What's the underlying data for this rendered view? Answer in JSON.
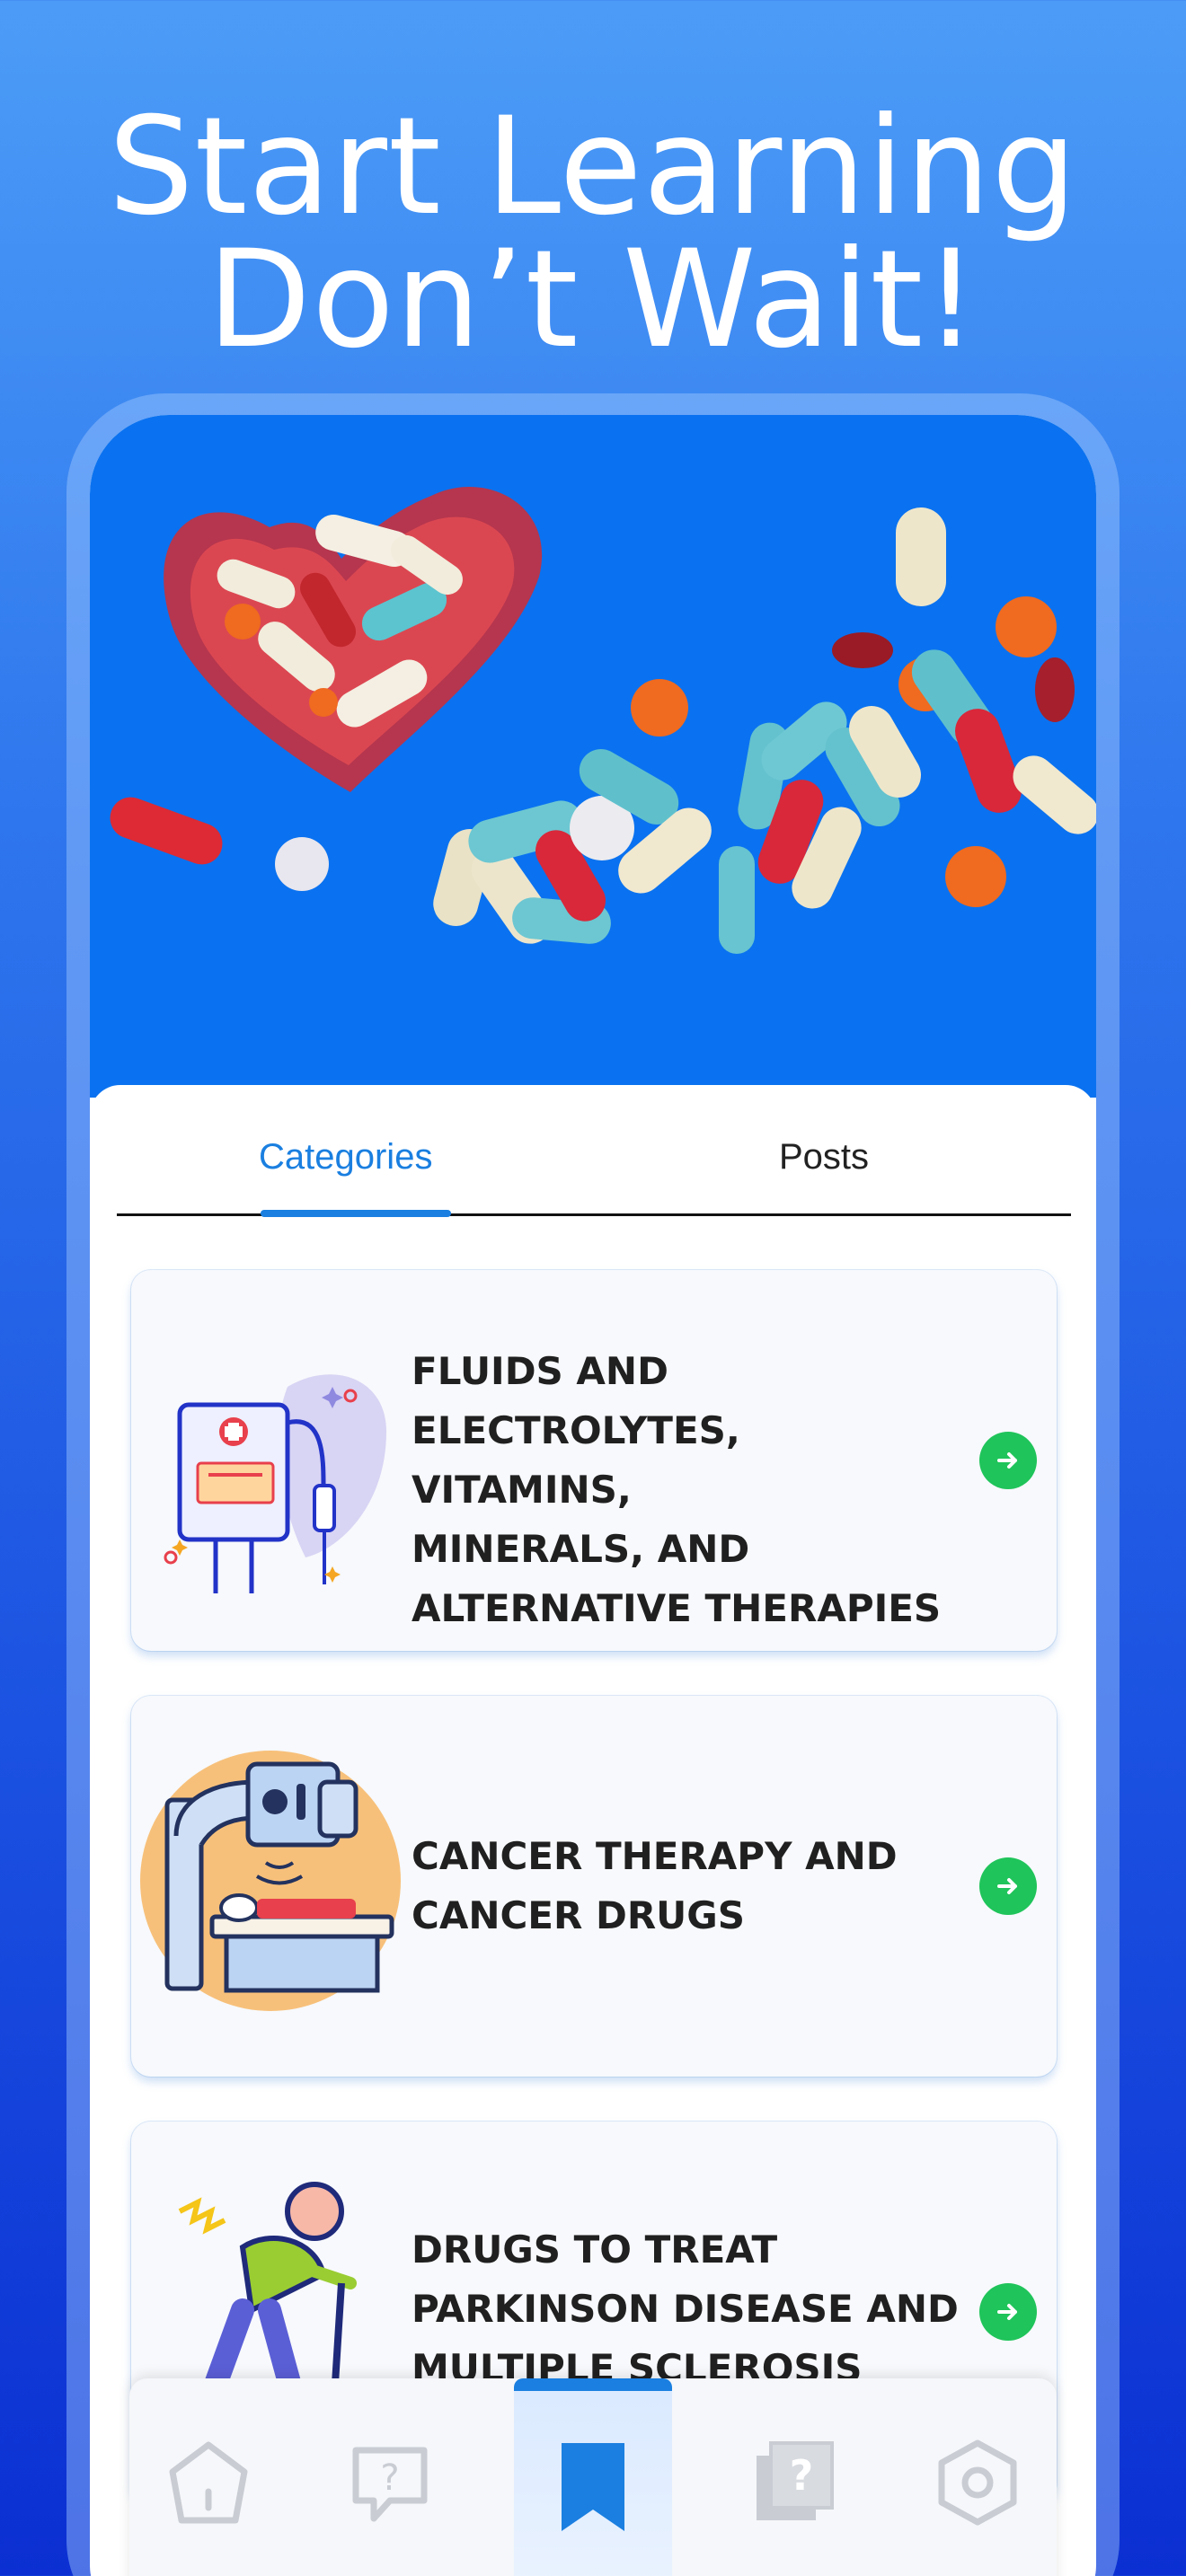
{
  "headline": {
    "line1": "Start Learning",
    "line2": "Don’t Wait!"
  },
  "hero": {
    "image": "pills-in-heart-bowl-on-blue",
    "background": "#0a72f0"
  },
  "tabs": [
    {
      "label": "Categories",
      "active": true
    },
    {
      "label": "Posts",
      "active": false
    }
  ],
  "categories": [
    {
      "icon": "iv-drip-icon",
      "title_lines": [
        "FLUIDS AND",
        "ELECTROLYTES, VITAMINS,",
        "MINERALS, AND",
        "ALTERNATIVE THERAPIES"
      ]
    },
    {
      "icon": "radiation-therapy-machine-icon",
      "title_lines": [
        "CANCER THERAPY AND",
        "CANCER DRUGS"
      ]
    },
    {
      "icon": "elderly-person-with-cane-icon",
      "title_lines": [
        "DRUGS TO TREAT",
        "PARKINSON DISEASE AND",
        "MULTIPLE SCLEROSIS"
      ]
    }
  ],
  "bottom_nav": [
    {
      "icon": "home-icon",
      "active": false
    },
    {
      "icon": "question-chat-icon",
      "active": false
    },
    {
      "icon": "bookmark-icon",
      "active": true
    },
    {
      "icon": "quiz-cards-icon",
      "active": false
    },
    {
      "icon": "settings-icon",
      "active": false
    }
  ],
  "colors": {
    "accent": "#1a7fe0",
    "arrow_green": "#1fc45a",
    "title_text": "#202020"
  }
}
